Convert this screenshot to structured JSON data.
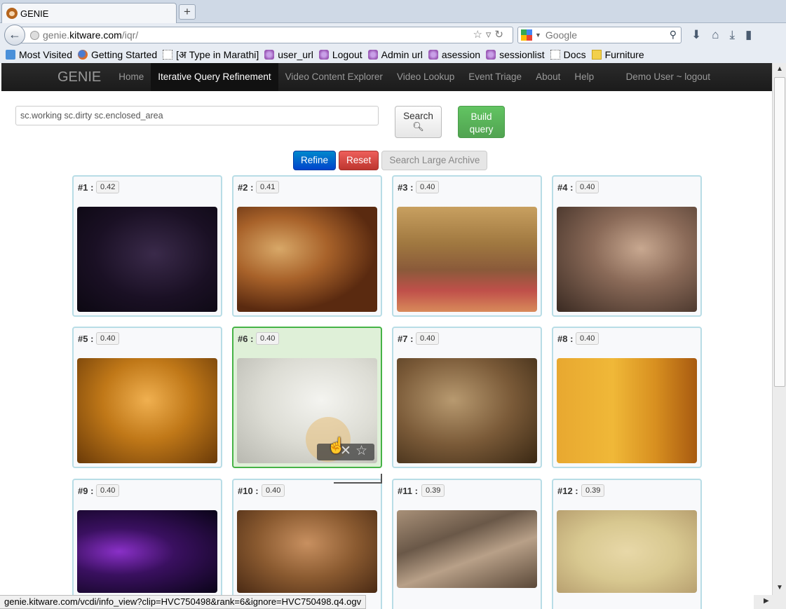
{
  "browser": {
    "tab_title": "GENIE",
    "new_tab": "+",
    "url_prefix": "genie.",
    "url_domain": "kitware.com",
    "url_path": "/iqr/",
    "search_placeholder": "Google",
    "bookmarks": [
      {
        "label": "Most Visited",
        "icon": "star"
      },
      {
        "label": "Getting Started",
        "icon": "ff"
      },
      {
        "label": "[अ Type in Marathi]",
        "icon": "page"
      },
      {
        "label": "user_url",
        "icon": "purple"
      },
      {
        "label": "Logout",
        "icon": "purple"
      },
      {
        "label": "Admin url",
        "icon": "purple"
      },
      {
        "label": "asession",
        "icon": "purple"
      },
      {
        "label": "sessionlist",
        "icon": "purple"
      },
      {
        "label": "Docs",
        "icon": "page"
      },
      {
        "label": "Furniture",
        "icon": "folder"
      }
    ],
    "status_url": "genie.kitware.com/vcdi/info_view?clip=HVC750498&rank=6&ignore=HVC750498.q4.ogv"
  },
  "app": {
    "brand": "GENIE",
    "nav": [
      "Home",
      "Iterative Query Refinement",
      "Video Content Explorer",
      "Video Lookup",
      "Event Triage",
      "About",
      "Help"
    ],
    "active_nav": "Iterative Query Refinement",
    "user": "Demo User ~ logout"
  },
  "query": {
    "value": "sc.working sc.dirty sc.enclosed_area",
    "search_label": "Search",
    "build_label_1": "Build",
    "build_label_2": "query",
    "refine_label": "Refine",
    "reset_label": "Reset",
    "archive_label": "Search Large Archive"
  },
  "results": [
    {
      "rank": "#1 :",
      "score": "0.42"
    },
    {
      "rank": "#2 :",
      "score": "0.41"
    },
    {
      "rank": "#3 :",
      "score": "0.40"
    },
    {
      "rank": "#4 :",
      "score": "0.40"
    },
    {
      "rank": "#5 :",
      "score": "0.40"
    },
    {
      "rank": "#6 :",
      "score": "0.40"
    },
    {
      "rank": "#7 :",
      "score": "0.40"
    },
    {
      "rank": "#8 :",
      "score": "0.40"
    },
    {
      "rank": "#9 :",
      "score": "0.40"
    },
    {
      "rank": "#10 :",
      "score": "0.40"
    },
    {
      "rank": "#11 :",
      "score": "0.39"
    },
    {
      "rank": "#12 :",
      "score": "0.39"
    }
  ],
  "selected_result": 6,
  "overlay_icons": [
    "reject-icon",
    "star-icon"
  ],
  "colors": {
    "accent_blue": "#0074cc",
    "danger": "#bd362f",
    "success": "#51a351",
    "card_border": "#b8dde6",
    "selected_border": "#46b346"
  }
}
